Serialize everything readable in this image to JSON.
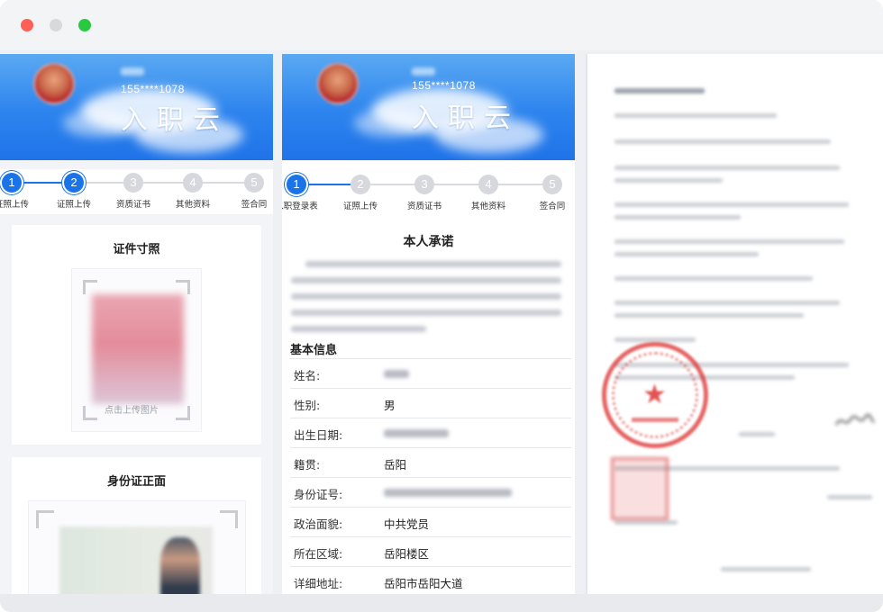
{
  "window": {
    "controls": [
      "close",
      "minimize",
      "maximize"
    ]
  },
  "colors": {
    "accent": "#1a73e8",
    "seal": "#dc3232"
  },
  "left_screen": {
    "banner": {
      "phone": "155****1078",
      "brand": "入职云"
    },
    "steps": [
      {
        "num": "1",
        "label": "证照上传",
        "active": true
      },
      {
        "num": "2",
        "label": "证照上传",
        "active": true
      },
      {
        "num": "3",
        "label": "资质证书",
        "active": false
      },
      {
        "num": "4",
        "label": "其他资料",
        "active": false
      },
      {
        "num": "5",
        "label": "签合同",
        "active": false
      }
    ],
    "photo_card": {
      "title": "证件寸照",
      "hint": "点击上传图片"
    },
    "id_card": {
      "title": "身份证正面"
    }
  },
  "middle_screen": {
    "banner": {
      "phone": "155****1078",
      "brand": "入职云"
    },
    "steps": [
      {
        "num": "1",
        "label": "入职登录表",
        "active": true
      },
      {
        "num": "2",
        "label": "证照上传",
        "active": false
      },
      {
        "num": "3",
        "label": "资质证书",
        "active": false
      },
      {
        "num": "4",
        "label": "其他资料",
        "active": false
      },
      {
        "num": "5",
        "label": "签合同",
        "active": false
      }
    ],
    "promise_title": "本人承诺",
    "basic_info_title": "基本信息",
    "fields": [
      {
        "label": "姓名:",
        "value": ""
      },
      {
        "label": "性别:",
        "value": "男"
      },
      {
        "label": "出生日期:",
        "value": ""
      },
      {
        "label": "籍贯:",
        "value": "岳阳"
      },
      {
        "label": "身份证号:",
        "value": ""
      },
      {
        "label": "政治面貌:",
        "value": "中共党员"
      },
      {
        "label": "所在区域:",
        "value": "岳阳楼区"
      },
      {
        "label": "详细地址:",
        "value": "岳阳市岳阳大道"
      }
    ]
  },
  "right_screen": {
    "icons": [
      "seal-icon",
      "signature-icon"
    ]
  }
}
